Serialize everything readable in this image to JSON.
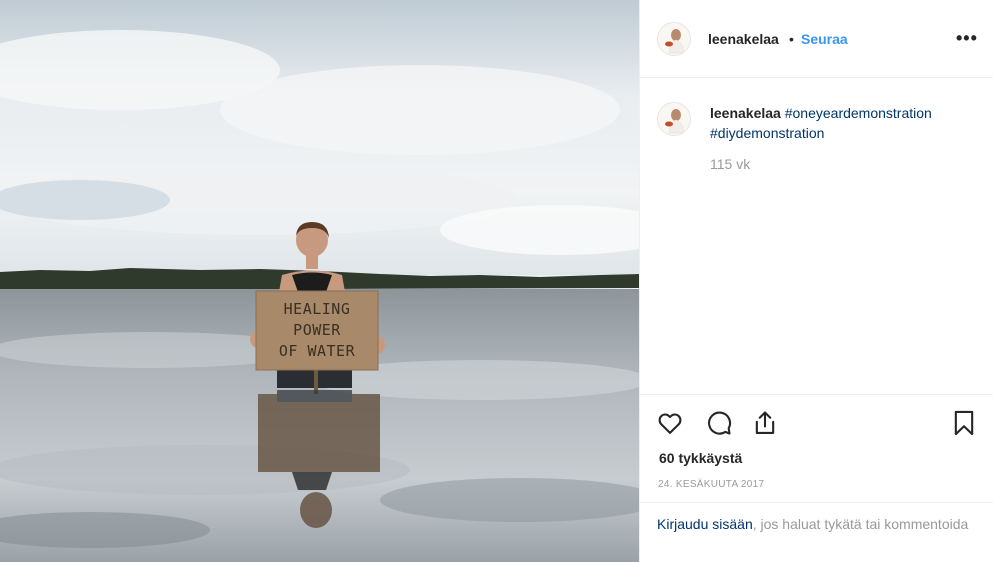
{
  "post": {
    "username": "leenakelaa",
    "dot": "•",
    "follow_label": "Seuraa",
    "more_label": "•••",
    "caption": {
      "username": "leenakelaa",
      "hashtag1": "#oneyeardemonstration",
      "hashtag2": "#diydemonstration"
    },
    "time_ago": "115 vk",
    "likes": "60 tykkäystä",
    "date": "24. KESÄKUUTA 2017"
  },
  "photo": {
    "sign_lines": [
      "HEALING",
      "POWER",
      "OF WATER"
    ]
  },
  "login": {
    "link": "Kirjaudu sisään",
    "rest": ", jos haluat tykätä tai kommentoida"
  },
  "icons": {
    "like": "heart-icon",
    "comment": "comment-icon",
    "share": "share-icon",
    "save": "bookmark-icon"
  },
  "colors": {
    "follow": "#3897f0",
    "hashtag": "#003569",
    "muted": "#999999",
    "text": "#262626"
  }
}
